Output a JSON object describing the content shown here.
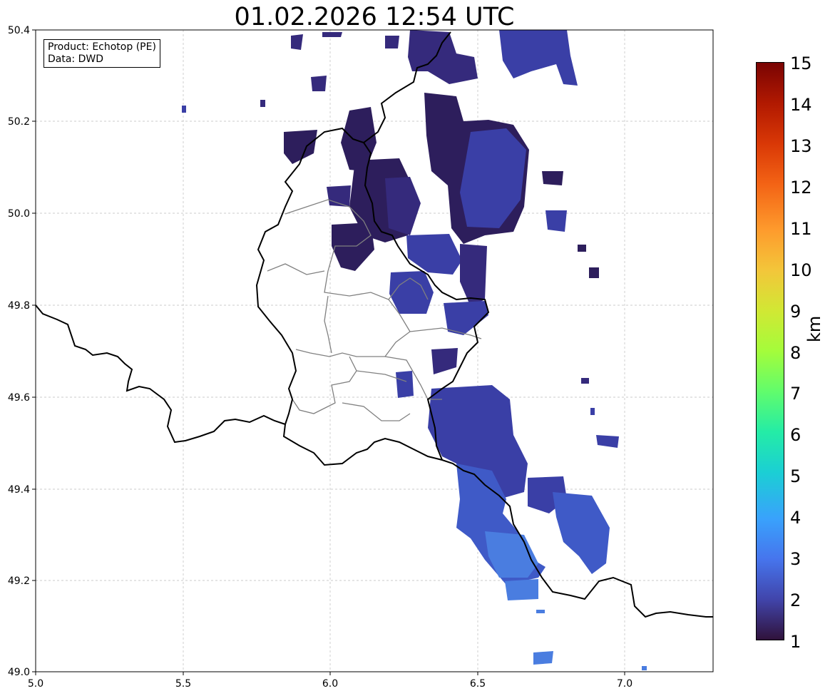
{
  "title": "01.02.2026 12:54 UTC",
  "infobox": {
    "line1": "Product: Echotop (PE)",
    "line2": "Data: DWD"
  },
  "map": {
    "lon_range": [
      5.0,
      7.3
    ],
    "lat_range": [
      49.0,
      50.4
    ],
    "x_ticks": [
      "5.0",
      "5.5",
      "6.0",
      "6.5",
      "7.0"
    ],
    "y_ticks": [
      "49.0",
      "49.2",
      "49.4",
      "49.6",
      "49.8",
      "50.0",
      "50.2",
      "50.4"
    ],
    "grid": true,
    "precip_colors": {
      "low": "#2d1e5c",
      "mid": "#3a3fa6",
      "high": "#4a7de0"
    }
  },
  "colorbar": {
    "colormap": "turbo",
    "min": 1,
    "max": 15,
    "labels": [
      "15",
      "14",
      "13",
      "12",
      "11",
      "10",
      "9",
      "8",
      "7",
      "6",
      "5",
      "4",
      "3",
      "2",
      "1"
    ],
    "unit": "km"
  }
}
